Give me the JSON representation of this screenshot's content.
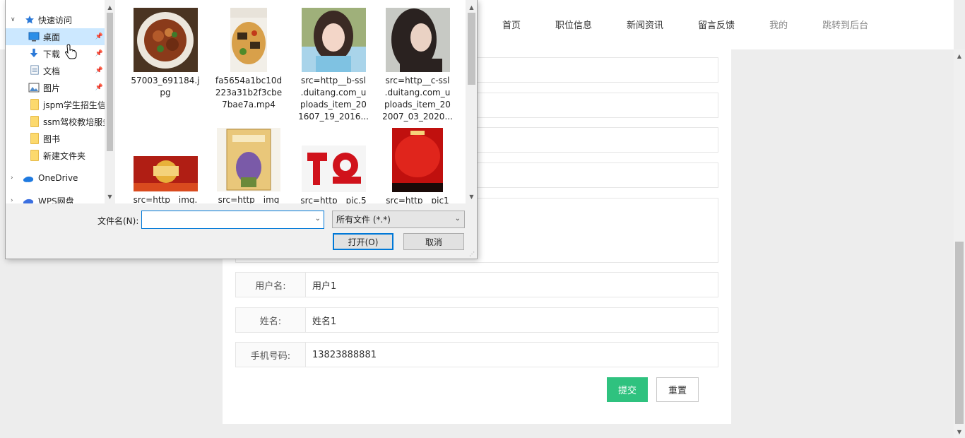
{
  "nav": {
    "items": [
      {
        "label": "首页",
        "muted": false
      },
      {
        "label": "职位信息",
        "muted": false
      },
      {
        "label": "新闻资讯",
        "muted": false
      },
      {
        "label": "留言反馈",
        "muted": false
      },
      {
        "label": "我的",
        "muted": true
      },
      {
        "label": "跳转到后台",
        "muted": true
      }
    ]
  },
  "form": {
    "username_label": "用户名:",
    "username_value": "用户1",
    "name_label": "姓名:",
    "name_value": "姓名1",
    "phone_label": "手机号码:",
    "phone_value": "13823888881",
    "submit_label": "提交",
    "reset_label": "重置",
    "submit_color": "#2fc27f"
  },
  "dialog": {
    "tree": {
      "quick_access": "快速访问",
      "items": [
        {
          "label": "桌面",
          "icon": "desktop-icon",
          "pinned": true,
          "selected": true
        },
        {
          "label": "下载",
          "icon": "download-icon",
          "pinned": true
        },
        {
          "label": "文档",
          "icon": "document-icon",
          "pinned": true
        },
        {
          "label": "图片",
          "icon": "pictures-icon",
          "pinned": true
        },
        {
          "label": "jspm学生招生信",
          "icon": "folder-icon"
        },
        {
          "label": "ssm驾校教培服务",
          "icon": "folder-icon"
        },
        {
          "label": "图书",
          "icon": "folder-icon"
        },
        {
          "label": "新建文件夹",
          "icon": "folder-icon"
        }
      ],
      "onedrive": "OneDrive",
      "wps": "WPS网盘"
    },
    "files": [
      {
        "name": "57003_691184.jpg",
        "lines": [
          "57003_691184.j",
          "pg"
        ]
      },
      {
        "name": "fa5654a1bc10d223a31b2f3cbe7bae7a.mp4",
        "lines": [
          "fa5654a1bc10d",
          "223a31b2f3cbe",
          "7bae7a.mp4"
        ]
      },
      {
        "name": "src=http__b-ssl.duitang.com_uploads_item_201607_19_2016...",
        "lines": [
          "src=http__b-ssl",
          ".duitang.com_u",
          "ploads_item_20",
          "1607_19_2016..."
        ]
      },
      {
        "name": "src=http__c-ssl.duitang.com_uploads_item_202007_03_2020...",
        "lines": [
          "src=http__c-ssl",
          ".duitang.com_u",
          "ploads_item_20",
          "2007_03_2020..."
        ]
      },
      {
        "name": "src=http__img.",
        "lines": [
          "src=http__img."
        ]
      },
      {
        "name": "src=http__img",
        "lines": [
          "src=http__img"
        ]
      },
      {
        "name": "src=http__pic.5",
        "lines": [
          "src=http__pic.5"
        ]
      },
      {
        "name": "src=http__pic1",
        "lines": [
          "src=http__pic1"
        ]
      }
    ],
    "filename_label": "文件名(N):",
    "filename_value": "",
    "filter_value": "所有文件 (*.*)",
    "open_label": "打开(O)",
    "cancel_label": "取消"
  }
}
